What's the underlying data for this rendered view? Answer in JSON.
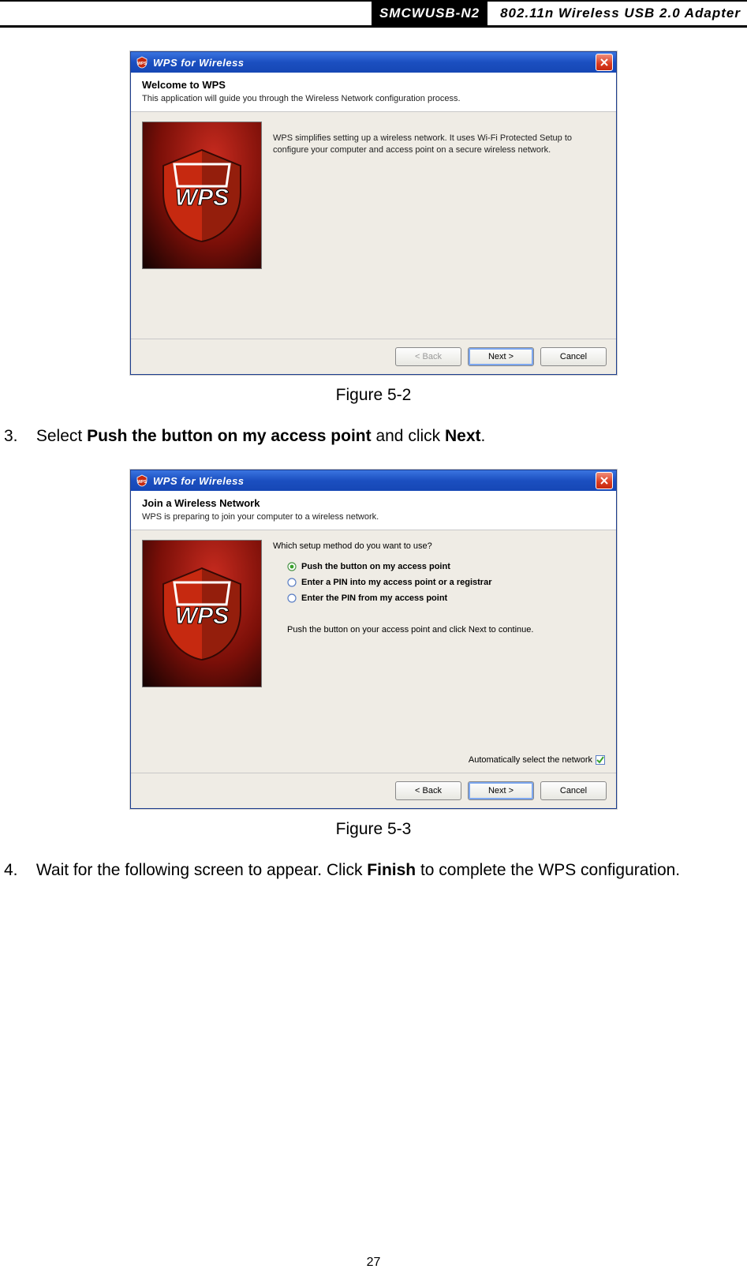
{
  "header": {
    "model": "SMCWUSB-N2",
    "desc": "802.11n Wireless USB 2.0 Adapter"
  },
  "dialog1": {
    "title": "WPS for Wireless",
    "close": "×",
    "banner_title": "Welcome to WPS",
    "banner_sub": "This application will guide you through the Wireless Network configuration process.",
    "body_text": "WPS simplifies setting up a wireless network. It uses Wi-Fi Protected Setup to configure your computer and access point on a secure wireless network.",
    "back": "< Back",
    "next": "Next >",
    "cancel": "Cancel"
  },
  "caption1": "Figure 5-2",
  "step3_num": "3.",
  "step3_a": "Select ",
  "step3_b": "Push the button on my access point",
  "step3_c": " and click ",
  "step3_d": "Next",
  "step3_e": ".",
  "dialog2": {
    "title": "WPS for Wireless",
    "close": "×",
    "banner_title": "Join a Wireless Network",
    "banner_sub": "WPS is preparing to join your computer to a wireless network.",
    "question": "Which setup method do you want to use?",
    "opt1": "Push the button on my access point",
    "opt2": "Enter a PIN into my access point or a registrar",
    "opt3": "Enter the PIN from my access point",
    "instr": "Push the button on your access point and click Next to continue.",
    "auto": "Automatically select the network",
    "back": "< Back",
    "next": "Next >",
    "cancel": "Cancel"
  },
  "caption2": "Figure 5-3",
  "step4_num": "4.",
  "step4_a": "Wait for the following screen to appear. Click ",
  "step4_b": "Finish",
  "step4_c": " to complete the WPS configuration.",
  "page_num": "27"
}
